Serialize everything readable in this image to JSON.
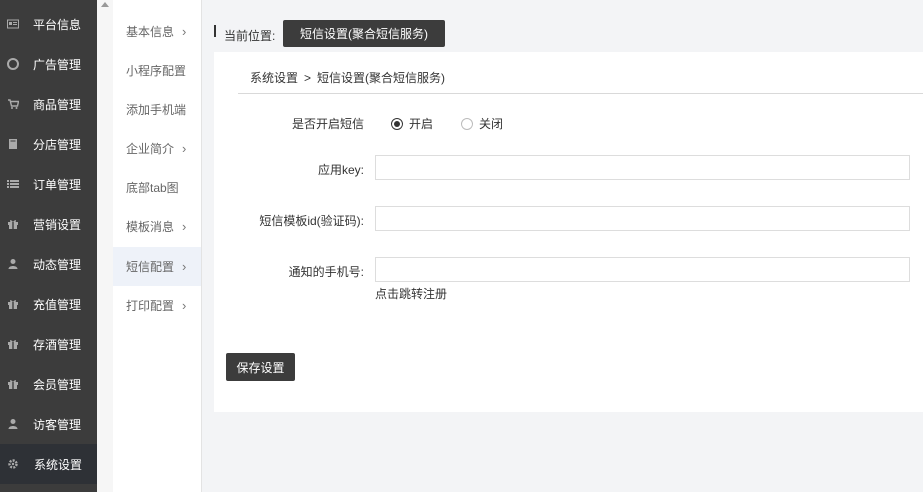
{
  "sidebar": {
    "items": [
      {
        "label": "平台信息",
        "icon": "newspaper-icon"
      },
      {
        "label": "广告管理",
        "icon": "life-ring-icon"
      },
      {
        "label": "商品管理",
        "icon": "cart-icon"
      },
      {
        "label": "分店管理",
        "icon": "book-icon"
      },
      {
        "label": "订单管理",
        "icon": "list-icon"
      },
      {
        "label": "营销设置",
        "icon": "gift-icon"
      },
      {
        "label": "动态管理",
        "icon": "user-icon"
      },
      {
        "label": "充值管理",
        "icon": "gift-icon"
      },
      {
        "label": "存酒管理",
        "icon": "gift-icon"
      },
      {
        "label": "会员管理",
        "icon": "gift-icon"
      },
      {
        "label": "访客管理",
        "icon": "user-icon"
      },
      {
        "label": "系统设置",
        "icon": "gear-icon"
      }
    ]
  },
  "submenu": {
    "items": [
      {
        "label": "基本信息",
        "chevron": "›"
      },
      {
        "label": "小程序配置",
        "chevron": ""
      },
      {
        "label": "添加手机端",
        "chevron": ""
      },
      {
        "label": "企业简介",
        "chevron": "›"
      },
      {
        "label": "底部tab图",
        "chevron": ""
      },
      {
        "label": "模板消息",
        "chevron": "›"
      },
      {
        "label": "短信配置",
        "chevron": "›"
      },
      {
        "label": "打印配置",
        "chevron": "›"
      }
    ]
  },
  "location": {
    "label": "当前位置:",
    "current": "短信设置(聚合短信服务)"
  },
  "panel": {
    "crumb_parent": "系统设置",
    "crumb_sep": ">",
    "crumb_current": "短信设置(聚合短信服务)"
  },
  "form": {
    "sms_enable_label": "是否开启短信",
    "radio_on": "开启",
    "radio_off": "关闭",
    "app_key_label": "应用key:",
    "app_key_value": "",
    "template_id_label": "短信模板id(验证码):",
    "template_id_value": "",
    "notify_phone_label": "通知的手机号:",
    "notify_phone_value": "",
    "register_link": "点击跳转注册",
    "save_label": "保存设置"
  }
}
